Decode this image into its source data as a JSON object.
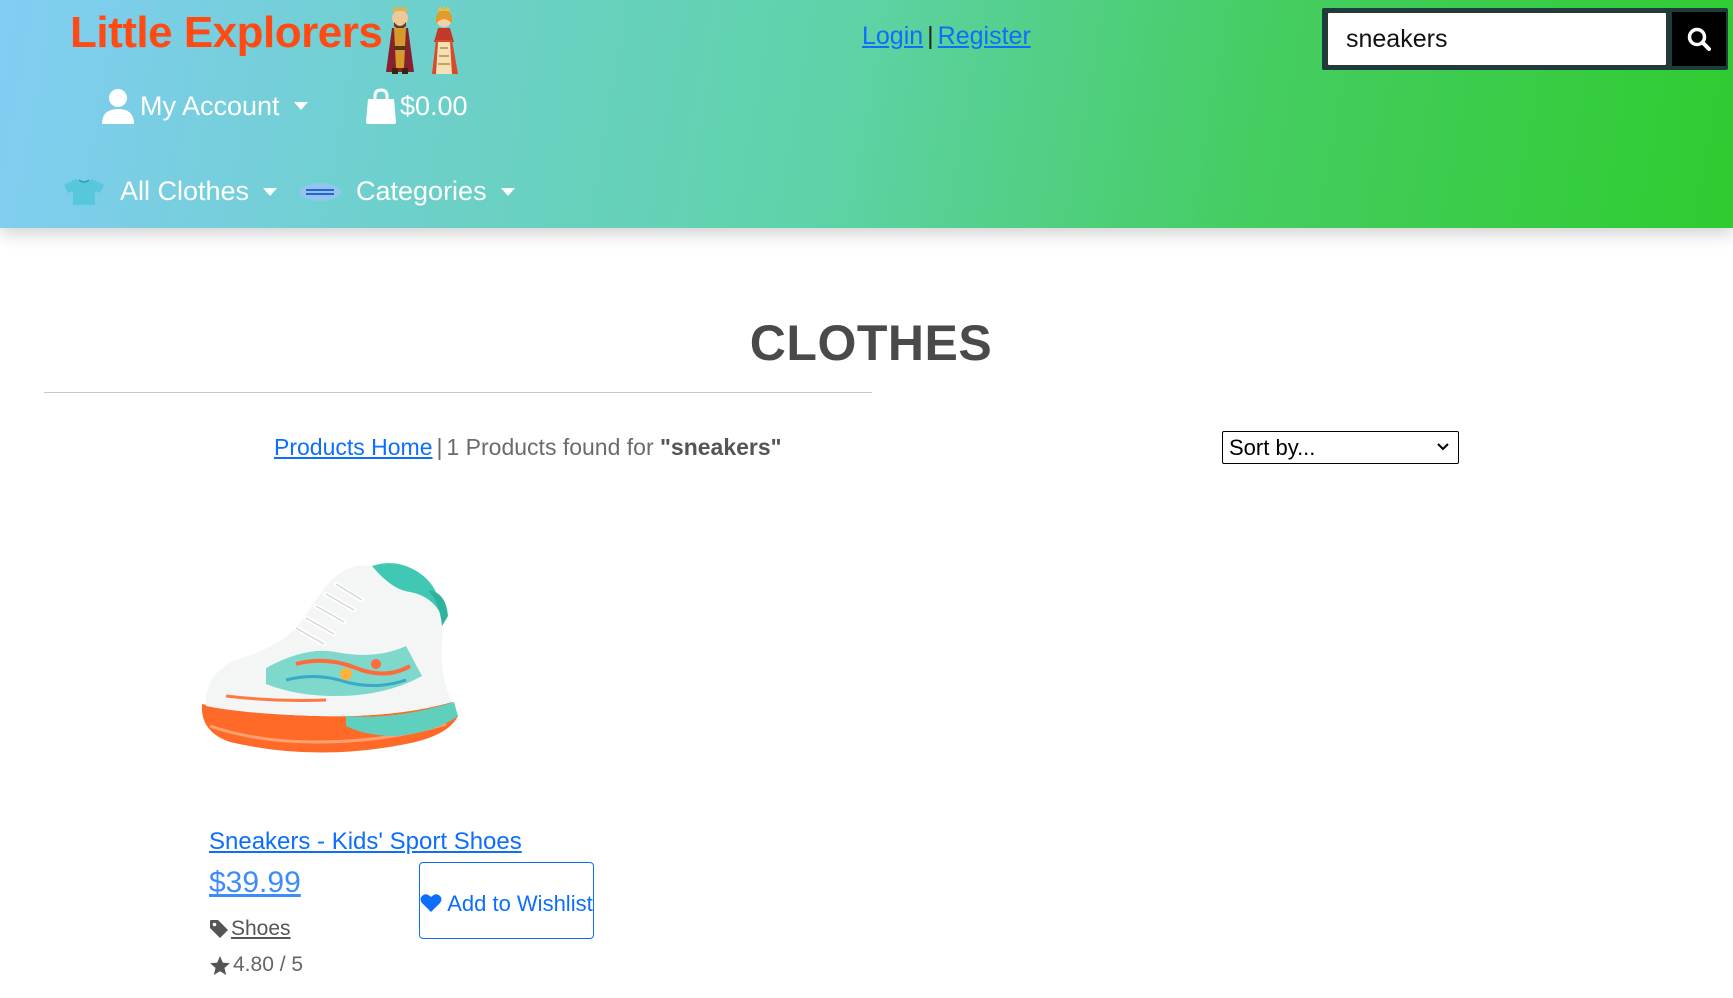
{
  "header": {
    "brand": "Little Explorers",
    "login_label": "Login",
    "separator": "|",
    "register_label": "Register",
    "search": {
      "value": "sneakers"
    },
    "account_label": "My Account",
    "cart_total": "$0.00",
    "nav": {
      "all_clothes_label": "All Clothes",
      "categories_label": "Categories"
    }
  },
  "main": {
    "title": "CLOTHES",
    "breadcrumb_link": "Products Home",
    "breadcrumb_separator": "|",
    "results_text": "1 Products found for",
    "results_query": "\"sneakers\"",
    "sort": {
      "selected": "Sort by..."
    },
    "products": [
      {
        "name": "Sneakers - Kids' Sport Shoes",
        "price": "$39.99",
        "wishlist_label": "Add to Wishlist",
        "category": "Shoes",
        "rating_text": "4.80 / 5",
        "image_icon": "sneaker-product-image"
      }
    ]
  },
  "colors": {
    "brand": "#ff4a14",
    "link": "#0d6efd",
    "header_gradient_start": "#82cdf4",
    "header_gradient_end": "#2fcb2f"
  }
}
